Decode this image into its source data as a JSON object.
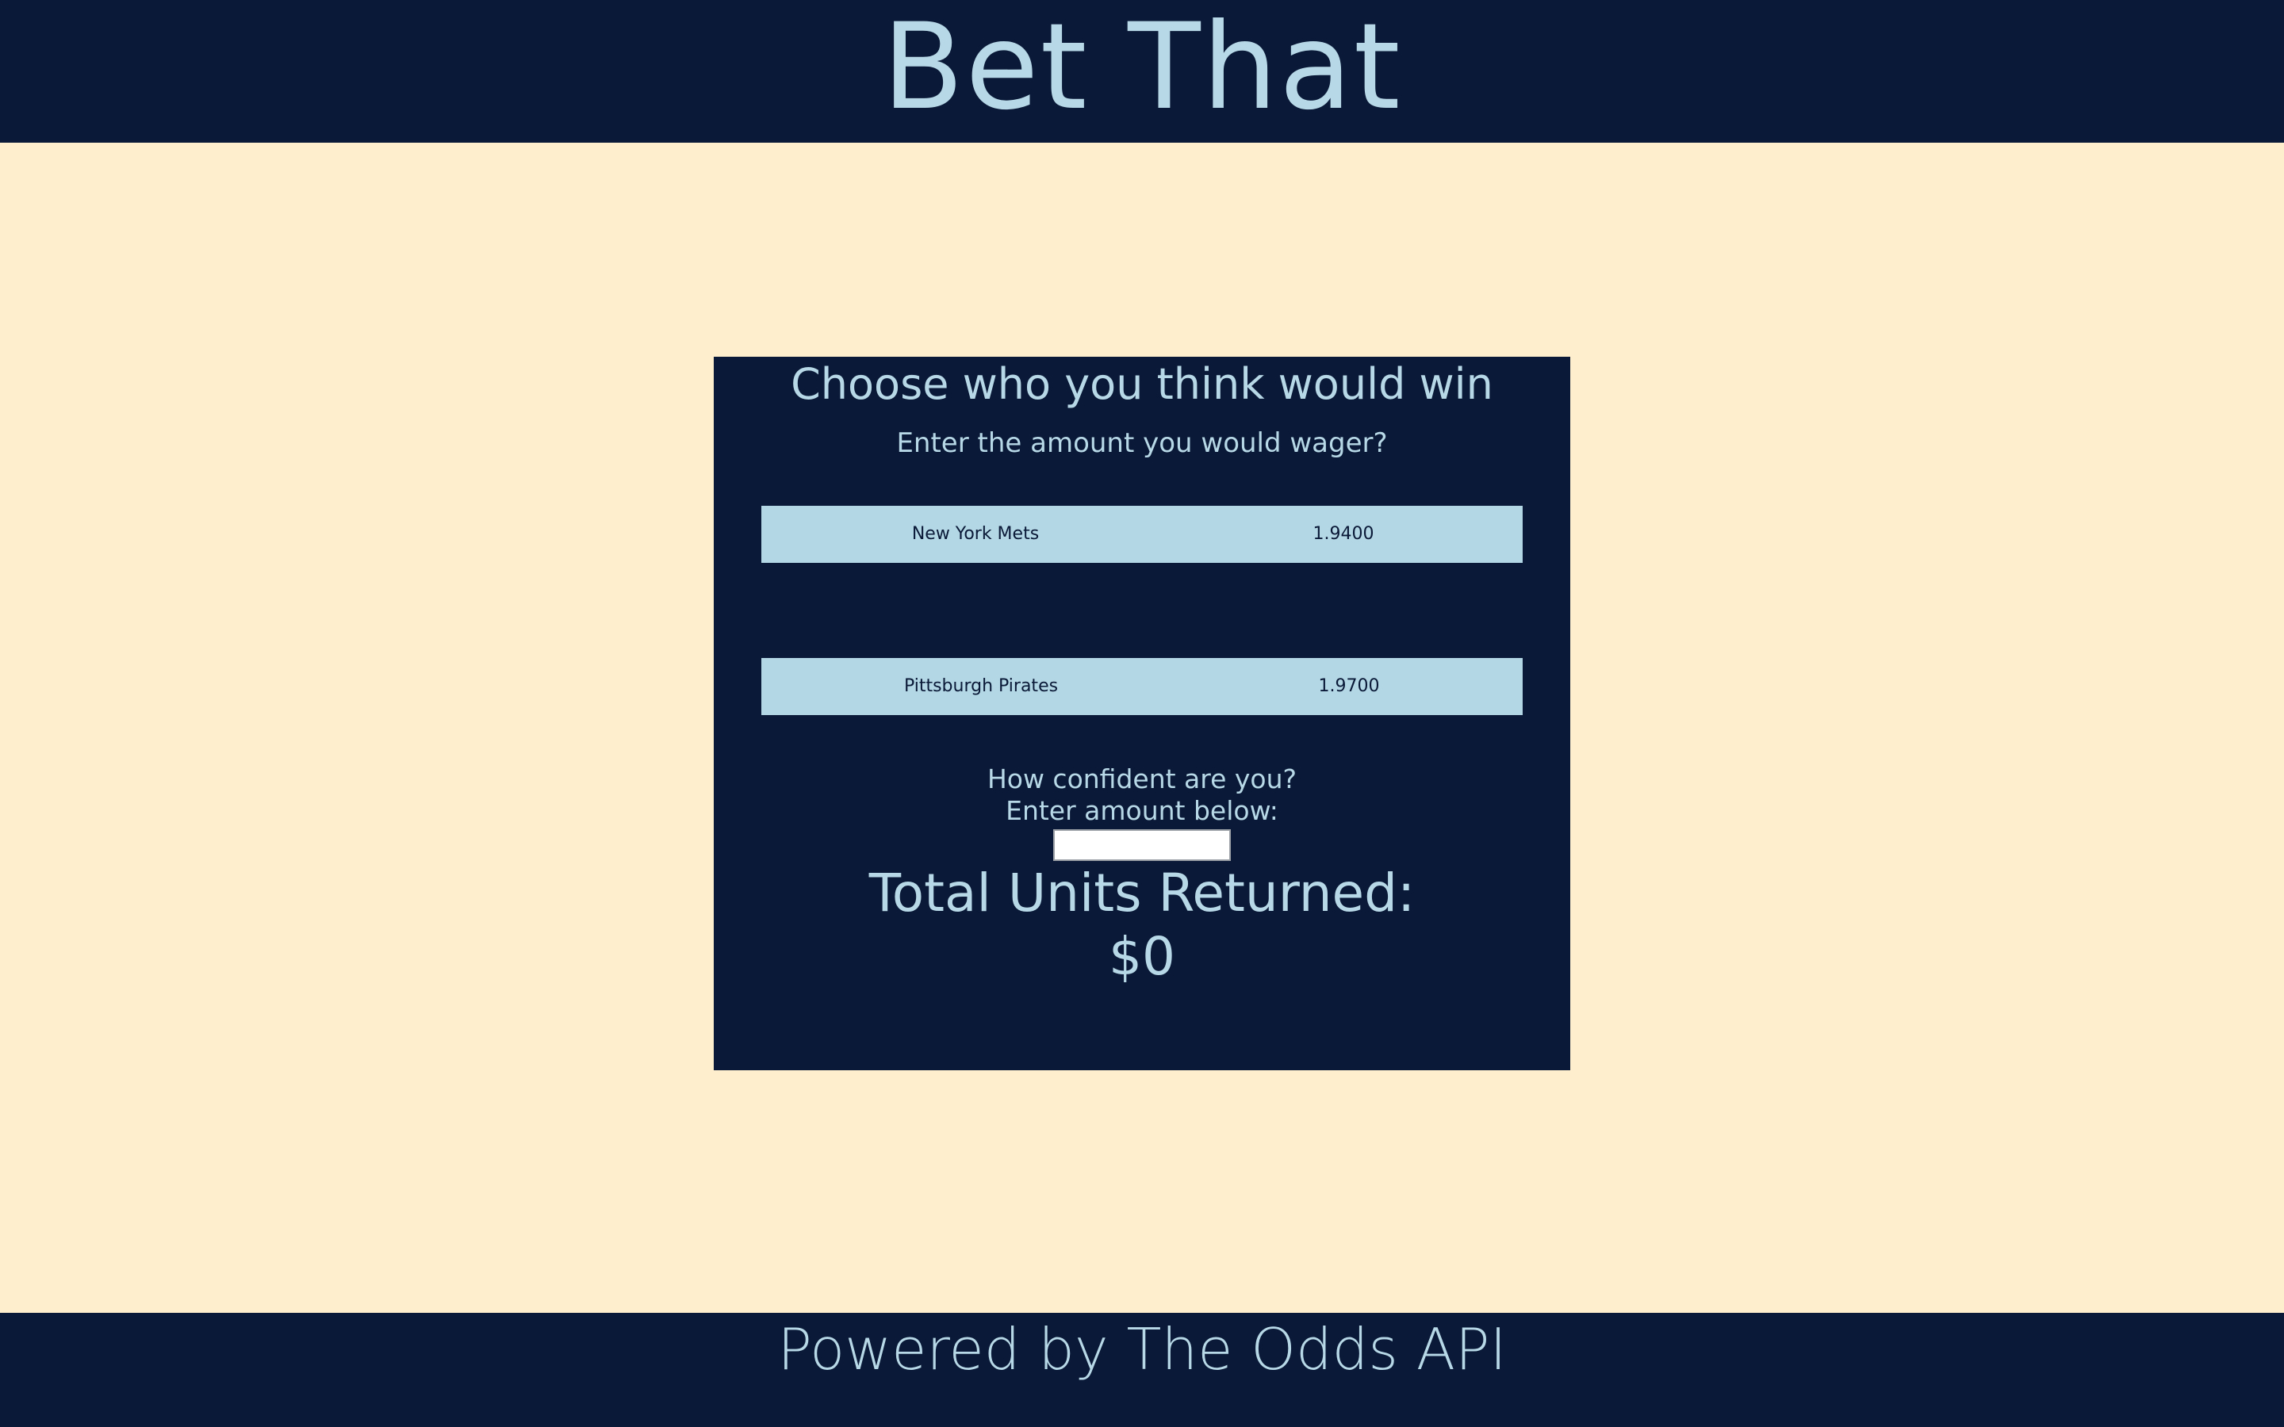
{
  "header": {
    "title": "Bet That"
  },
  "card": {
    "title": "Choose who you think would win",
    "subtitle": "Enter the amount you would wager?",
    "teams": [
      {
        "name": "New York Mets",
        "odds": "1.9400"
      },
      {
        "name": "Pittsburgh Pirates",
        "odds": "1.9700"
      }
    ],
    "confidence_prompt": "How confident are you?",
    "amount_prompt": "Enter amount below:",
    "amount_input": {
      "value": "",
      "placeholder": ""
    },
    "total_label": "Total Units Returned:",
    "total_value": "$0"
  },
  "footer": {
    "text": "Powered by The Odds API"
  },
  "colors": {
    "background": "#feeecd",
    "navy": "#0a1937",
    "light_blue": "#b7d8e6",
    "row_blue": "#b3d7e4"
  }
}
